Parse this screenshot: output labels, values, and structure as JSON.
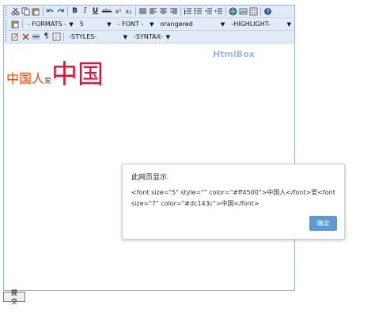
{
  "toolbar1": {
    "bold_label": "B",
    "italic_label": "I",
    "underline_label": "U",
    "strike_label": "abc",
    "superscript_label": "x²",
    "subscript_label": "x₂",
    "help_label": "?"
  },
  "toolbar2": {
    "formats_label": "- FORMATS -",
    "size_value": "5",
    "font_label": "- FONT -",
    "color_value": "orangered",
    "highlight_label": "-HIGHLIGHT-"
  },
  "toolbar3": {
    "styles_label": "-STYLES-",
    "syntax_label": "-SYNTAX-"
  },
  "editor": {
    "brand": "HtmlBox",
    "text1": "中国人",
    "text2": "爱",
    "text3": "中国"
  },
  "dialog": {
    "title": "此网页显示",
    "message": "<font size=\"5\" style=\"\" color=\"#ff4500\">中国人</font>爱<font size=\"7\" color=\"#dc143c\">中国</font>",
    "ok_label": "确定"
  },
  "form": {
    "submit_label": "提交"
  },
  "colors": {
    "text1": "#ff4500",
    "text3": "#dc143c",
    "button_primary": "#5b9bd5",
    "toolbar_bg": "#e3ebf6",
    "brand": "#9fb8e0"
  }
}
